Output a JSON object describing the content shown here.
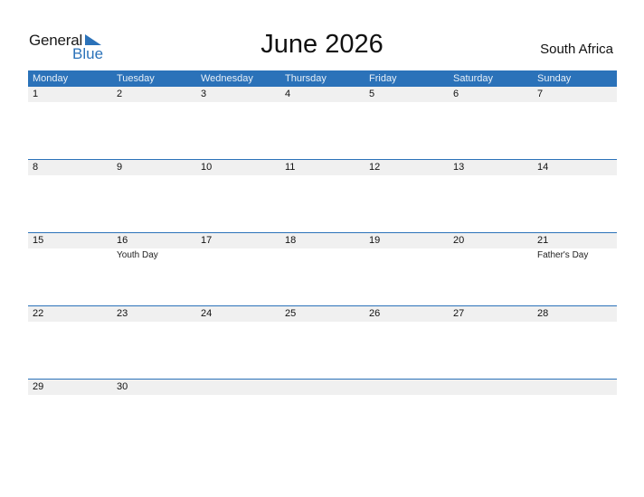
{
  "logo": {
    "word1": "General",
    "word2": "Blue"
  },
  "title": "June 2026",
  "country": "South Africa",
  "colors": {
    "accent": "#2b72b9",
    "date_strip": "#f0f0f0"
  },
  "weekdays": [
    "Monday",
    "Tuesday",
    "Wednesday",
    "Thursday",
    "Friday",
    "Saturday",
    "Sunday"
  ],
  "weeks": [
    {
      "days": [
        {
          "num": "1"
        },
        {
          "num": "2"
        },
        {
          "num": "3"
        },
        {
          "num": "4"
        },
        {
          "num": "5"
        },
        {
          "num": "6"
        },
        {
          "num": "7"
        }
      ]
    },
    {
      "days": [
        {
          "num": "8"
        },
        {
          "num": "9"
        },
        {
          "num": "10"
        },
        {
          "num": "11"
        },
        {
          "num": "12"
        },
        {
          "num": "13"
        },
        {
          "num": "14"
        }
      ]
    },
    {
      "days": [
        {
          "num": "15"
        },
        {
          "num": "16",
          "event": "Youth Day"
        },
        {
          "num": "17"
        },
        {
          "num": "18"
        },
        {
          "num": "19"
        },
        {
          "num": "20"
        },
        {
          "num": "21",
          "event": "Father's Day"
        }
      ]
    },
    {
      "days": [
        {
          "num": "22"
        },
        {
          "num": "23"
        },
        {
          "num": "24"
        },
        {
          "num": "25"
        },
        {
          "num": "26"
        },
        {
          "num": "27"
        },
        {
          "num": "28"
        }
      ]
    },
    {
      "days": [
        {
          "num": "29"
        },
        {
          "num": "30"
        },
        {
          "num": ""
        },
        {
          "num": ""
        },
        {
          "num": ""
        },
        {
          "num": ""
        },
        {
          "num": ""
        }
      ]
    }
  ]
}
